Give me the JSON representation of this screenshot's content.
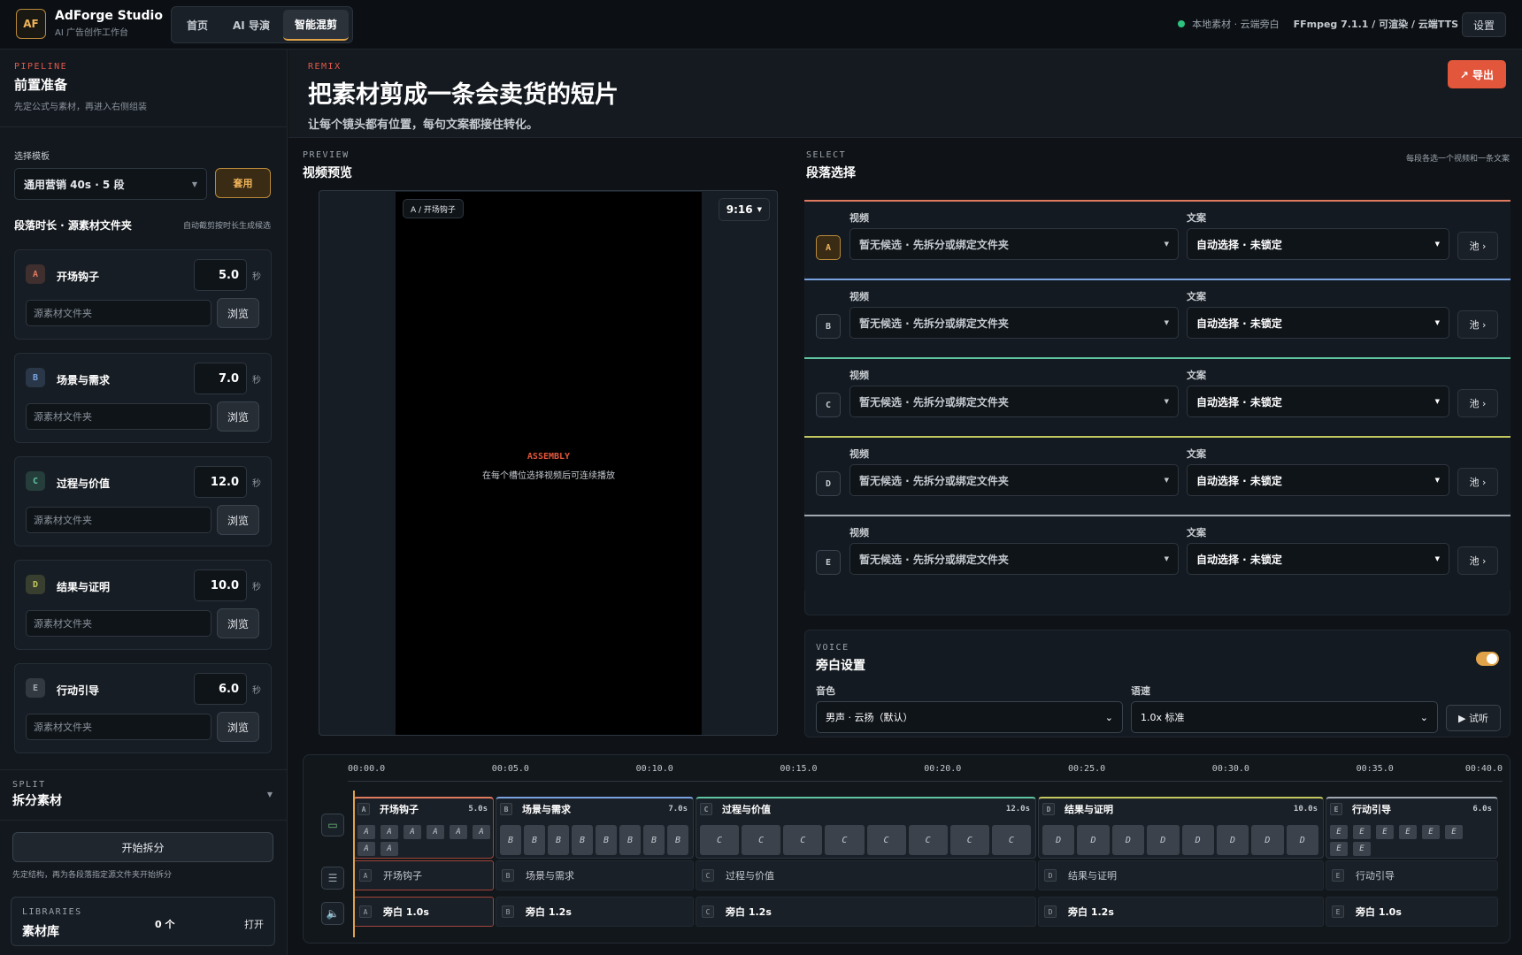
{
  "app": {
    "logo": "AF",
    "name": "AdForge Studio",
    "subtitle": "AI 广告创作工作台"
  },
  "nav": {
    "tabs": [
      "首页",
      "AI 导演",
      "智能混剪"
    ],
    "active": 2
  },
  "status": {
    "text": "本地素材 · 云端旁白",
    "ffmpeg": "FFmpeg 7.1.1 / 可渲染 / 云端TTS",
    "settings": "设置"
  },
  "pipeline": {
    "kicker": "PIPELINE",
    "title": "前置准备",
    "desc": "先定公式与素材，再进入右侧组装",
    "template_label": "选择模板",
    "template_value": "通用营销 40s · 5 段",
    "apply": "套用",
    "seg_title": "段落时长 · 源素材文件夹",
    "seg_hint": "自动截剪按时长生成候选",
    "folder_placeholder": "源素材文件夹",
    "browse": "浏览",
    "unit": "秒",
    "segments": [
      {
        "id": "A",
        "name": "开场钩子",
        "dur": "5.0",
        "color": "#e07a5f"
      },
      {
        "id": "B",
        "name": "场景与需求",
        "dur": "7.0",
        "color": "#7aa2e0"
      },
      {
        "id": "C",
        "name": "过程与价值",
        "dur": "12.0",
        "color": "#5fc4a0"
      },
      {
        "id": "D",
        "name": "结果与证明",
        "dur": "10.0",
        "color": "#c4c95f"
      },
      {
        "id": "E",
        "name": "行动引导",
        "dur": "6.0",
        "color": "#a0a8b2"
      }
    ]
  },
  "split": {
    "kicker": "SPLIT",
    "title": "拆分素材",
    "button": "开始拆分",
    "desc": "先定结构，再为各段落指定源文件夹开始拆分"
  },
  "libraries": {
    "kicker": "LIBRARIES",
    "title": "素材库",
    "count": "0 个",
    "open": "打开"
  },
  "hero": {
    "kicker": "REMIX",
    "title": "把素材剪成一条会卖货的短片",
    "desc": "让每个镜头都有位置，每句文案都接住转化。",
    "export": "↗ 导出"
  },
  "preview": {
    "kicker": "PREVIEW",
    "title": "视频预览",
    "slot_tag": "A / 开场钩子",
    "ratio": "9:16",
    "assembly": "ASSEMBLY",
    "assembly_hint": "在每个槽位选择视频后可连续播放"
  },
  "select": {
    "kicker": "SELECT",
    "title": "段落选择",
    "hint": "每段各选一个视频和一条文案",
    "video_label": "视频",
    "copy_label": "文案",
    "video_value": "暂无候选 · 先拆分或绑定文件夹",
    "copy_value": "自动选择 · 未锁定",
    "pool": "池 ›"
  },
  "voice": {
    "kicker": "VOICE",
    "title": "旁白设置",
    "timbre_label": "音色",
    "timbre_value": "男声 · 云扬（默认）",
    "speed_label": "语速",
    "speed_value": "1.0x 标准",
    "try": "▶ 试听",
    "enabled": true
  },
  "timeline": {
    "ticks": [
      "00:00.0",
      "00:05.0",
      "00:10.0",
      "00:15.0",
      "00:20.0",
      "00:25.0",
      "00:30.0",
      "00:35.0",
      "00:40.0"
    ],
    "clips": [
      {
        "id": "A",
        "name": "开场钩子",
        "dur": "5.0s",
        "voice": "旁白 1.0s",
        "frames": 8
      },
      {
        "id": "B",
        "name": "场景与需求",
        "dur": "7.0s",
        "voice": "旁白 1.2s",
        "frames": 8
      },
      {
        "id": "C",
        "name": "过程与价值",
        "dur": "12.0s",
        "voice": "旁白 1.2s",
        "frames": 8
      },
      {
        "id": "D",
        "name": "结果与证明",
        "dur": "10.0s",
        "voice": "旁白 1.2s",
        "frames": 8
      },
      {
        "id": "E",
        "name": "行动引导",
        "dur": "6.0s",
        "voice": "旁白 1.0s",
        "frames": 8
      }
    ]
  }
}
